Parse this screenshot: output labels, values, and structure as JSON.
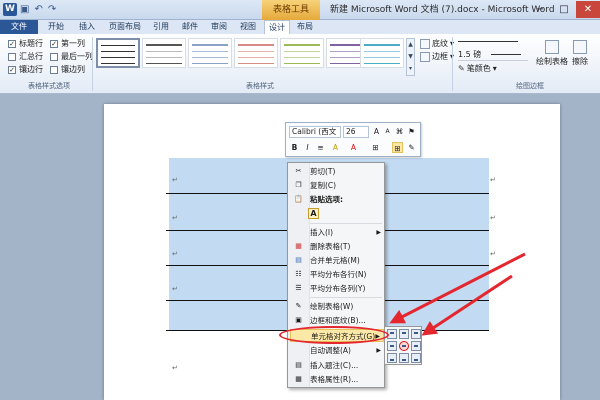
{
  "titlebar": {
    "app_icon": "W",
    "qat": [
      "save-icon",
      "undo-icon",
      "redo-icon"
    ],
    "context_tab_title": "表格工具",
    "window_title": "新建 Microsoft Word 文档 (7).docx - Microsoft Word",
    "controls": [
      "−",
      "□",
      "✕"
    ]
  },
  "tabs": [
    "文件",
    "开始",
    "插入",
    "页面布局",
    "引用",
    "邮件",
    "审阅",
    "视图",
    "设计",
    "布局"
  ],
  "ribbon": {
    "options_group": {
      "label": "表格样式选项",
      "checkboxes": [
        {
          "label": "标题行",
          "checked": true
        },
        {
          "label": "汇总行",
          "checked": false
        },
        {
          "label": "镶边行",
          "checked": true
        },
        {
          "label": "第一列",
          "checked": true
        },
        {
          "label": "最后一列",
          "checked": false
        },
        {
          "label": "镶边列",
          "checked": false
        }
      ]
    },
    "styles_group": {
      "label": "表格样式"
    },
    "shading_label": "底纹",
    "borders_label": "边框",
    "pen_weight": "1.5 磅",
    "pen_color_label": "笔颜色",
    "draw_table_label": "绘制表格",
    "erase_label": "擦除",
    "draw_borders_group": {
      "label": "绘图边框"
    }
  },
  "minibar": {
    "font": "Calibri (西文",
    "size": "26",
    "row2": [
      "B",
      "I",
      "≡",
      "A",
      "A",
      "⊞",
      "✎"
    ]
  },
  "context_menu": {
    "cut": "剪切(T)",
    "copy": "复制(C)",
    "paste_options": "粘贴选项:",
    "paste_a": "A",
    "insert": "插入(I)",
    "delete_table": "删除表格(T)",
    "merge_cells": "合并单元格(M)",
    "distribute_rows": "平均分布各行(N)",
    "distribute_cols": "平均分布各列(Y)",
    "draw_table": "绘制表格(W)",
    "borders_shading": "边框和底纹(B)...",
    "cell_alignment": "单元格对齐方式(G)",
    "autofit": "自动调整(A)",
    "insert_caption": "插入题注(C)...",
    "table_properties": "表格属性(R)..."
  },
  "colors": {
    "accent_red": "#e4262f",
    "table_fill": "#c2daf2",
    "file_tab": "#2b5797"
  }
}
